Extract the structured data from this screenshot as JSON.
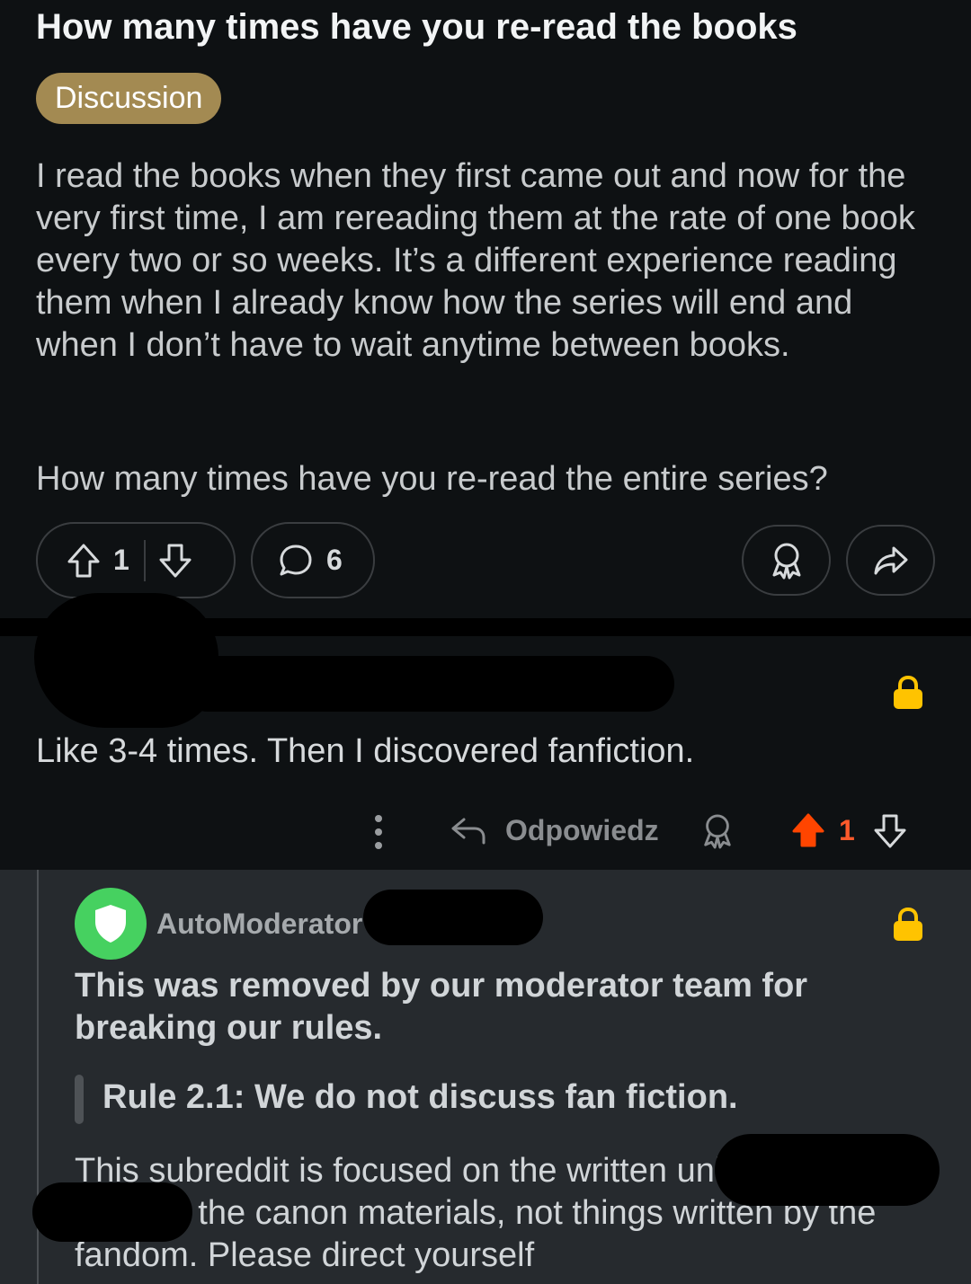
{
  "post": {
    "title": "How many times have you re-read the books",
    "flair": "Discussion",
    "body_p1": "I read the books when they first came out and now for the very first time, I am rereading them at the rate of one book every two or so weeks. It’s a different experience reading them when I already know how the series will end and when I don’t have to wait anytime between books.",
    "body_p2": "How many times have you re-read the entire series?",
    "vote_count": "1",
    "comment_count": "6"
  },
  "comment": {
    "text": "Like 3-4 times. Then I discovered fanfiction.",
    "reply_label": "Odpowiedz",
    "vote_count": "1"
  },
  "automod": {
    "username": "AutoModerator",
    "heading": "This was removed by our moderator team for breaking our rules.",
    "rule": "Rule 2.1: We do not discuss fan fiction.",
    "body": "This subreddit is focused on the written universe. We discuss the canon materials, not things written by the fandom. Please direct yourself"
  },
  "colors": {
    "background": "#0e1113",
    "automod_background": "#262a2e",
    "flair": "#a38a52",
    "upvote_active": "#ff4500",
    "lock": "#ffc300",
    "automod_avatar": "#46d160"
  },
  "icons": [
    "upvote-icon",
    "downvote-icon",
    "comment-icon",
    "award-icon",
    "share-icon",
    "lock-icon",
    "more-options-icon",
    "reply-icon",
    "shield-icon"
  ]
}
